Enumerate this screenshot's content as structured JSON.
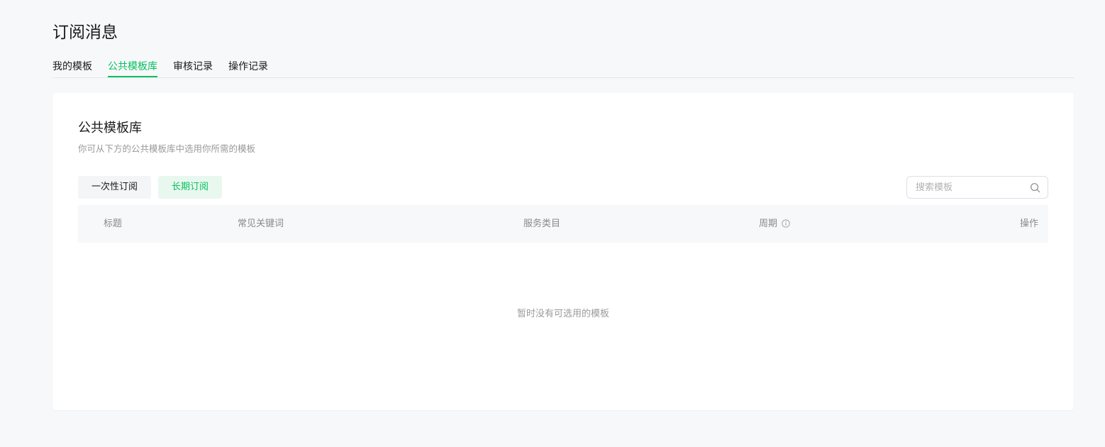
{
  "header": {
    "title": "订阅消息"
  },
  "tabs": [
    {
      "label": "我的模板",
      "active": false
    },
    {
      "label": "公共模板库",
      "active": true
    },
    {
      "label": "审核记录",
      "active": false
    },
    {
      "label": "操作记录",
      "active": false
    }
  ],
  "card": {
    "title": "公共模板库",
    "description": "你可从下方的公共模板库中选用你所需的模板"
  },
  "filters": {
    "once_label": "一次性订阅",
    "long_label": "长期订阅",
    "active": "long"
  },
  "search": {
    "placeholder": "搜索模板",
    "value": "",
    "icon": "search-icon"
  },
  "table": {
    "columns": {
      "title": "标题",
      "keywords": "常见关键词",
      "category": "服务类目",
      "period": "周期",
      "actions": "操作"
    },
    "rows": [],
    "empty_text": "暂时没有可选用的模板"
  },
  "colors": {
    "accent": "#07c160",
    "accent_bg": "#e9f8ef",
    "page_bg": "#f7f8fa",
    "text_primary": "#1a1a1a",
    "text_secondary": "#9a9a9a"
  }
}
